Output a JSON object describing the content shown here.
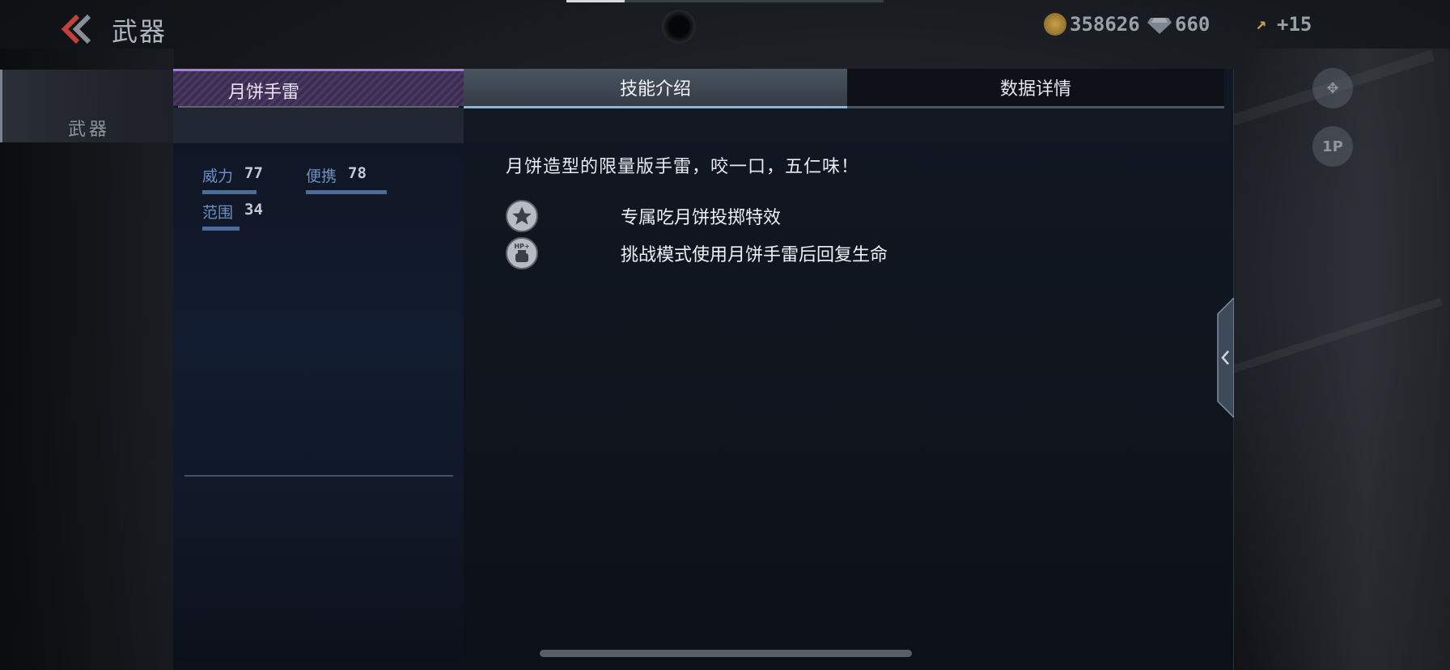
{
  "header": {
    "title": "武器",
    "coins": "358626",
    "gems": "660",
    "level": "+15"
  },
  "sidebar": {
    "tab_label": "武器"
  },
  "right_buttons": {
    "view_label": "1P"
  },
  "weapon": {
    "name": "月饼手雷",
    "stats": [
      {
        "label": "威力",
        "value": "77"
      },
      {
        "label": "便携",
        "value": "78"
      },
      {
        "label": "范围",
        "value": "34"
      }
    ]
  },
  "tabs": {
    "skills": "技能介绍",
    "data": "数据详情",
    "active": "skills"
  },
  "details": {
    "description": "月饼造型的限量版手雷，咬一口，五仁味！",
    "skills": [
      {
        "icon": "star-icon",
        "text": "专属吃月饼投掷特效"
      },
      {
        "icon": "hp-potion-icon",
        "icon_label": "HP+",
        "text": "挑战模式使用月饼手雷后回复生命"
      }
    ]
  }
}
